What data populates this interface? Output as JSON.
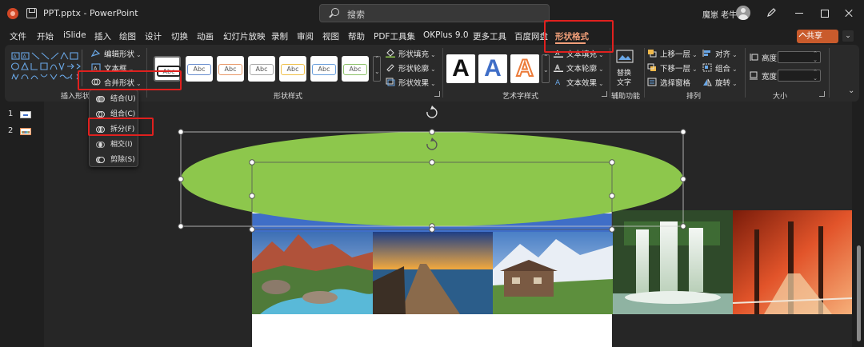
{
  "titlebar": {
    "filename": "PPT.pptx",
    "separator": "-",
    "app": "PowerPoint",
    "search_placeholder": "搜索",
    "user": "魔崽 老牛"
  },
  "tabs": [
    "文件",
    "开始",
    "iSlide",
    "插入",
    "绘图",
    "设计",
    "切换",
    "动画",
    "幻灯片放映",
    "录制",
    "审阅",
    "视图",
    "帮助",
    "PDF工具集",
    "OKPlus 9.0",
    "更多工具",
    "百度网盘",
    "形状格式"
  ],
  "active_tab": "形状格式",
  "share_button": "共享",
  "groups": {
    "insert_shapes": {
      "label": "插入形状",
      "edit_shape": "编辑形状",
      "text_box": "文本框",
      "merge_shapes": "合并形状"
    },
    "shape_styles": {
      "label": "形状样式",
      "swatches": [
        "Abc",
        "Abc",
        "Abc",
        "Abc",
        "Abc",
        "Abc",
        "Abc"
      ],
      "fill": "形状填充",
      "outline": "形状轮廓",
      "effects": "形状效果"
    },
    "wordart": {
      "label": "艺术字样式",
      "samples": [
        "A",
        "A",
        "A"
      ],
      "text_fill": "文本填充",
      "text_outline": "文本轮廓",
      "text_effects": "文本效果"
    },
    "accessibility": {
      "label": "辅助功能",
      "alt_text_line1": "替换",
      "alt_text_line2": "文字"
    },
    "arrange": {
      "label": "排列",
      "bring_forward": "上移一层",
      "send_backward": "下移一层",
      "selection_pane": "选择窗格",
      "align": "对齐",
      "group": "组合",
      "rotate": "旋转"
    },
    "size": {
      "label": "大小",
      "height_label": "高度:",
      "width_label": "宽度:"
    }
  },
  "merge_menu": [
    {
      "label": "结合(U)"
    },
    {
      "label": "组合(C)"
    },
    {
      "label": "拆分(F)"
    },
    {
      "label": "相交(I)"
    },
    {
      "label": "剪除(S)"
    }
  ],
  "highlighted_menu_item": "拆分(F)",
  "slides": [
    "1",
    "2"
  ],
  "colors": {
    "accent_tab": "#f2a07a",
    "ellipse_fill": "#8dc74c",
    "blue_band": "#3f6ec7",
    "highlight_red": "#e0201e",
    "share_button": "#c95b2c"
  },
  "photos": [
    "mountain-stream",
    "wooden-pier-sunset",
    "alpine-chalet",
    "waterfall",
    "autumn-forest"
  ]
}
